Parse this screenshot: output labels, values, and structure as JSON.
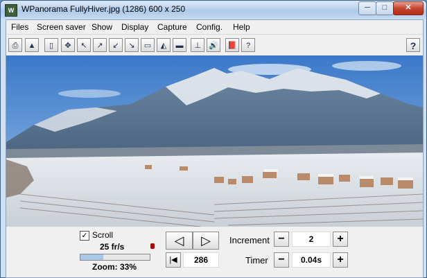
{
  "window": {
    "title": "WPanorama  FullyHiver.jpg  (1286) 600 x 250",
    "app_icon": "W",
    "minimize_glyph": "─",
    "maximize_glyph": "□",
    "close_glyph": "✕"
  },
  "menu": {
    "items": [
      "Files",
      "Screen saver",
      "Show",
      "Display",
      "Capture",
      "Config.",
      "Help"
    ]
  },
  "toolbar": {
    "buttons": [
      {
        "name": "print-icon",
        "glyph": "⎙"
      },
      {
        "name": "image-icon",
        "glyph": "▲"
      },
      {
        "name": "page-icon",
        "glyph": "▯"
      },
      {
        "name": "move-arrows-icon",
        "glyph": "✥"
      },
      {
        "name": "arrow-up-left-icon",
        "glyph": "↖"
      },
      {
        "name": "arrow-up-right-icon",
        "glyph": "↗"
      },
      {
        "name": "arrow-down-left-icon",
        "glyph": "↙"
      },
      {
        "name": "arrow-down-right-icon",
        "glyph": "↘"
      },
      {
        "name": "panorama-icon",
        "glyph": "▭"
      },
      {
        "name": "landscape-icon",
        "glyph": "◭"
      },
      {
        "name": "frame-icon",
        "glyph": "▬"
      },
      {
        "name": "position-icon",
        "glyph": "⊥"
      },
      {
        "name": "sound-icon",
        "glyph": "🔊"
      },
      {
        "name": "book-icon",
        "glyph": "📕"
      },
      {
        "name": "help-page-icon",
        "glyph": "?"
      }
    ],
    "help_label": "?"
  },
  "photo": {
    "name": "FullyHiver.jpg",
    "colors": {
      "sky_top": "#3b78c8",
      "sky_bottom": "#9cc4ec",
      "mountain": "#56708a",
      "snow": "#eef2f6",
      "valley": "#e7ebef"
    }
  },
  "controls": {
    "scroll_label": "Scroll",
    "scroll_checked": true,
    "check_mark": "✓",
    "fps_label": "25 fr/s",
    "zoom_label": "Zoom: 33%",
    "zoom_level": 0.33,
    "prev_glyph": "◁",
    "next_glyph": "▷",
    "first_glyph": "|◀",
    "position_value": "286",
    "increment_label": "Increment",
    "increment_value": "2",
    "timer_label": "Timer",
    "timer_value": "0.04s",
    "minus_glyph": "−",
    "plus_glyph": "+"
  }
}
